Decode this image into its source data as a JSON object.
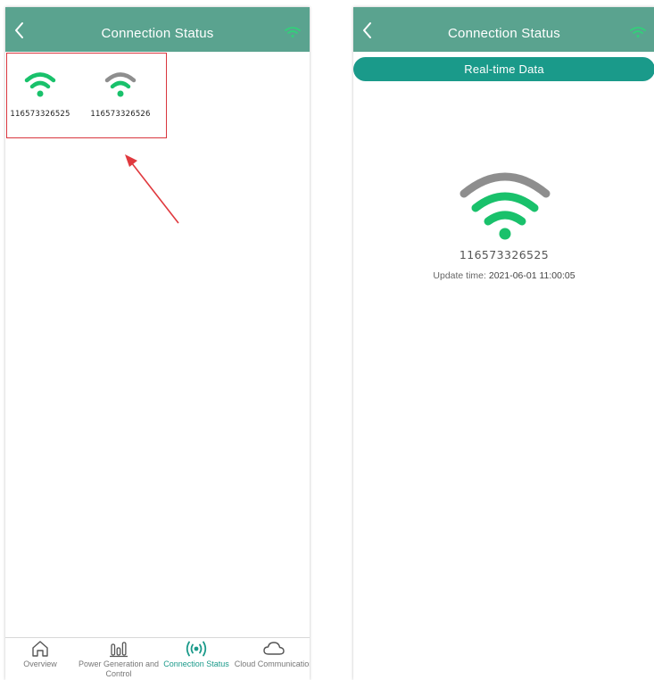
{
  "left_screen": {
    "header": {
      "title": "Connection Status",
      "back_icon": "chevron-left-icon",
      "status_icon": "wifi-icon"
    },
    "devices": [
      {
        "id": "116573326525",
        "status": "connected",
        "icon_color": "#19c16b"
      },
      {
        "id": "116573326526",
        "status": "disconnected",
        "icon_color": "#8e8e8e"
      }
    ],
    "bottom_nav": [
      {
        "label": "Overview",
        "icon": "home-icon",
        "active": false
      },
      {
        "label": "Power Generation and Control",
        "icon": "bar-chart-icon",
        "active": false
      },
      {
        "label": "Connection Status",
        "icon": "signal-broadcast-icon",
        "active": true
      },
      {
        "label": "Cloud Communication",
        "icon": "cloud-icon",
        "active": false
      }
    ]
  },
  "right_screen": {
    "header": {
      "title": "Connection Status",
      "back_icon": "chevron-left-icon",
      "status_icon": "wifi-icon"
    },
    "tab_label": "Real-time Data",
    "device_id": "116573326525",
    "update_label": "Update time:",
    "update_time": "2021-06-01 11:00:05"
  },
  "colors": {
    "header": "#5aa38f",
    "accent": "#1a9a8a",
    "connected": "#19c16b",
    "disconnected": "#8e8e8e",
    "highlight_box": "#d9363e",
    "annotation_arrow": "#e0393e"
  }
}
